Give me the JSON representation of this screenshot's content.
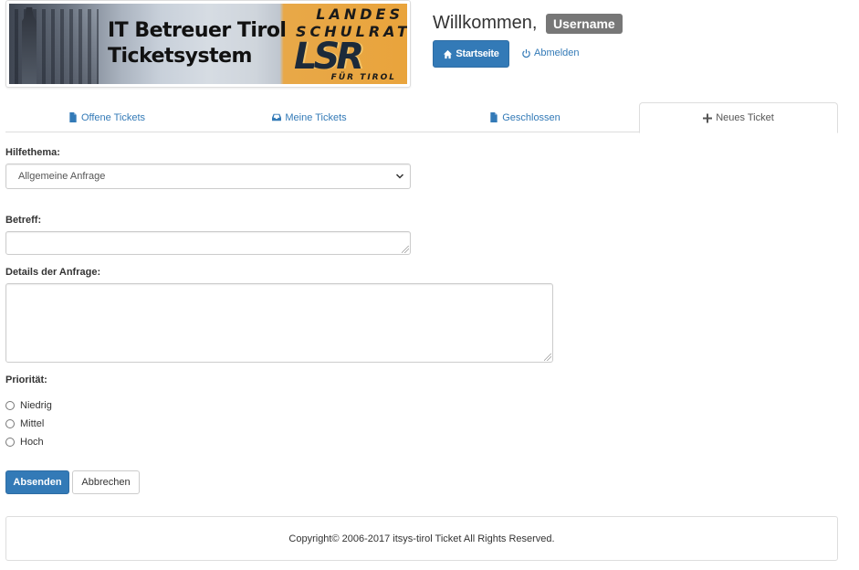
{
  "banner": {
    "title_line1": "IT Betreuer Tirol",
    "title_line2": "Ticketsystem",
    "org_line1": "LANDES",
    "org_line2": "SCHULRAT",
    "logo_text": "LSR",
    "logo_sub": "FÜR TIROL"
  },
  "header": {
    "welcome": "Willkommen,",
    "username": "Username",
    "home_label": "Startseite",
    "logout_label": "Abmelden"
  },
  "tabs": [
    {
      "label": "Offene Tickets",
      "icon": "file-icon"
    },
    {
      "label": "Meine Tickets",
      "icon": "inbox-icon"
    },
    {
      "label": "Geschlossen",
      "icon": "file-icon"
    },
    {
      "label": "Neues Ticket",
      "icon": "plus-icon",
      "active": true
    }
  ],
  "form": {
    "topic_label": "Hilfethema:",
    "topic_value": "Allgemeine Anfrage",
    "subject_label": "Betreff:",
    "subject_value": "",
    "details_label": "Details der Anfrage:",
    "details_value": "",
    "priority_label": "Priorität:",
    "priority_options": [
      "Niedrig",
      "Mittel",
      "Hoch"
    ],
    "submit_label": "Absenden",
    "cancel_label": "Abbrechen"
  },
  "footer": {
    "copyright": "Copyright© 2006-2017 itsys-tirol Ticket All Rights Reserved."
  },
  "colors": {
    "primary": "#337ab7",
    "badge": "#777777",
    "banner_accent": "#e9a43c"
  }
}
